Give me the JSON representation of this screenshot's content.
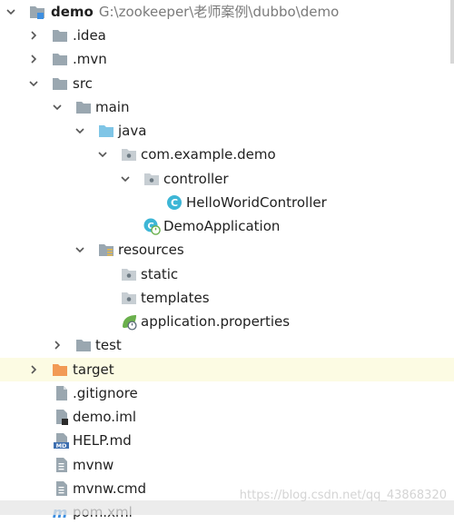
{
  "tree": {
    "root": {
      "name": "demo",
      "path": "G:\\zookeeper\\老师案例\\dubbo\\demo"
    },
    "nodes": {
      "idea": ".idea",
      "mvn": ".mvn",
      "src": "src",
      "main": "main",
      "java": "java",
      "package": "com.example.demo",
      "controller": "controller",
      "hello_controller": "HelloWoridController",
      "demo_application": "DemoApplication",
      "resources": "resources",
      "static": "static",
      "templates": "templates",
      "application_properties": "application.properties",
      "test": "test",
      "target": "target",
      "gitignore": ".gitignore",
      "demo_iml": "demo.iml",
      "help_md": "HELP.md",
      "mvnw": "mvnw",
      "mvnw_cmd": "mvnw.cmd",
      "pom_xml": "pom.xml"
    }
  },
  "colors": {
    "selected_row": "#fcfbe3",
    "folder_gray": "#9aa7b0",
    "folder_source": "#7fc5e6",
    "folder_target": "#f29a55",
    "class_icon": "#3db6d6",
    "spring_green": "#6ab04c"
  },
  "watermark": "https://blog.csdn.net/qq_43868320"
}
